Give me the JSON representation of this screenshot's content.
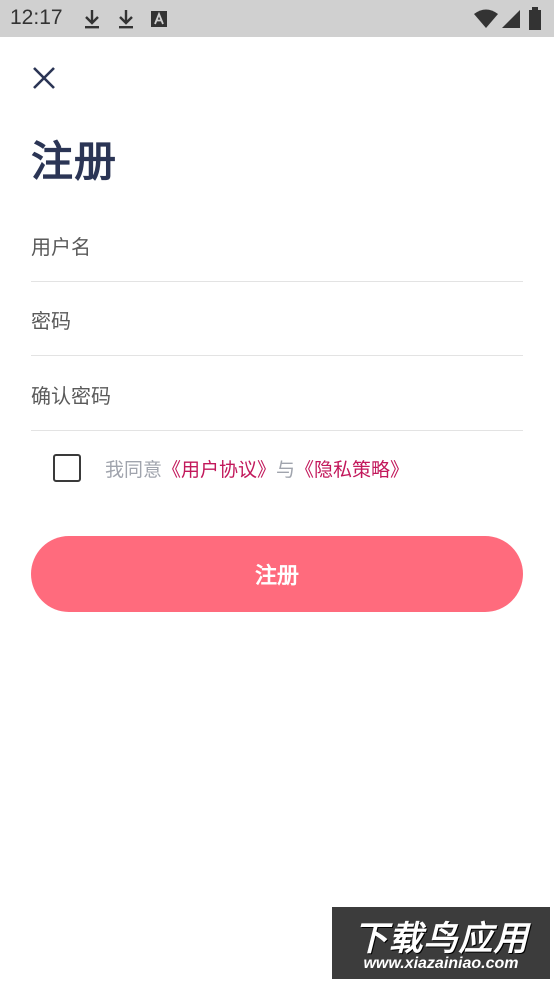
{
  "status_bar": {
    "time": "12:17",
    "left_icons": [
      "download-icon",
      "download-icon",
      "font-a-icon"
    ],
    "right_icons": [
      "wifi-icon",
      "signal-icon",
      "battery-icon"
    ]
  },
  "header": {
    "close_icon": "close-icon",
    "title": "注册"
  },
  "form": {
    "username_placeholder": "用户名",
    "password_placeholder": "密码",
    "confirm_password_placeholder": "确认密码",
    "agree_prefix": "我同意",
    "user_agreement": "《用户协议》",
    "agree_and": "与",
    "privacy_policy": "《隐私策略》",
    "agreed": false,
    "submit_label": "注册"
  },
  "watermark": {
    "title": "下载鸟应用",
    "url": "www.xiazainiao.com"
  },
  "colors": {
    "accent": "#ff6b7d",
    "link": "#c2185b",
    "title": "#2b3555"
  }
}
